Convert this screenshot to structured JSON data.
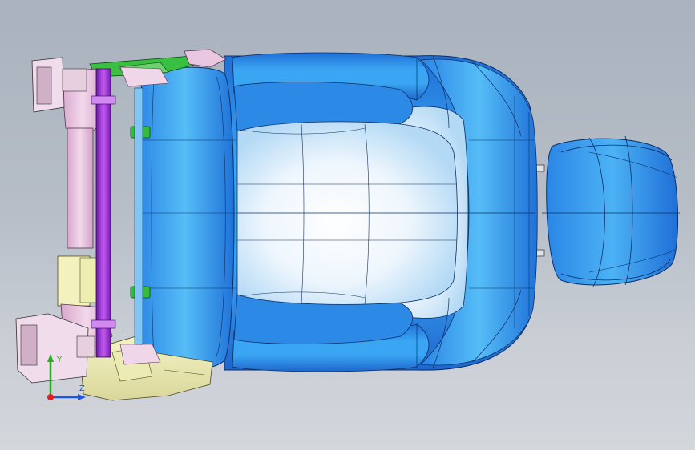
{
  "viewport": {
    "background_top": "#a9b2bd",
    "background_bottom": "#d3d6db"
  },
  "model": {
    "parts": [
      {
        "name": "seat-cushion",
        "color": "#2a8de8"
      },
      {
        "name": "seat-back",
        "color": "#2a8de8"
      },
      {
        "name": "headrest",
        "color": "#2a8de8"
      },
      {
        "name": "seat-frame",
        "color": "#e9c7e0"
      },
      {
        "name": "pivot-rod",
        "color": "#a12de0"
      },
      {
        "name": "side-trim",
        "color": "#f3f2be"
      },
      {
        "name": "bracket",
        "color": "#39c043"
      },
      {
        "name": "hinge-clip",
        "color": "#33bb3f"
      }
    ]
  },
  "triad": {
    "x_label": "",
    "y_label": "Y",
    "z_label": "Z",
    "colors": {
      "x": "#e02020",
      "y": "#22b022",
      "z": "#2255dd"
    }
  }
}
